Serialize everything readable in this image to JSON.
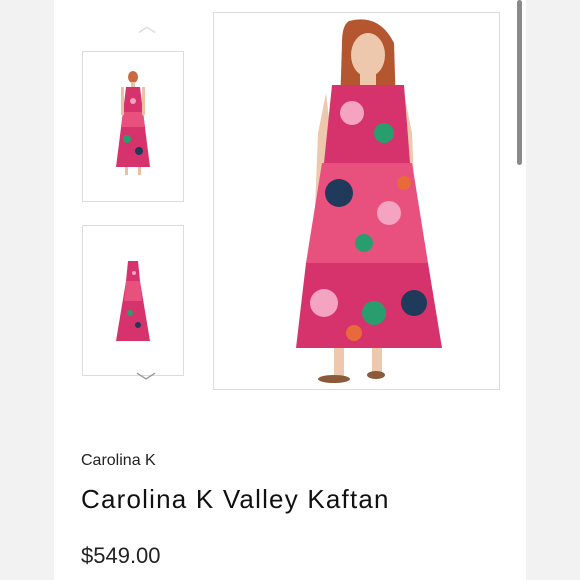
{
  "product": {
    "brand": "Carolina K",
    "title": "Carolina K Valley Kaftan",
    "price": "$549.00"
  },
  "gallery": {
    "prev_icon": "chevron-up-icon",
    "next_icon": "chevron-down-icon",
    "dress_colors": [
      "#d6336c",
      "#e8507e",
      "#2a9d6f",
      "#1f3a5a"
    ]
  }
}
